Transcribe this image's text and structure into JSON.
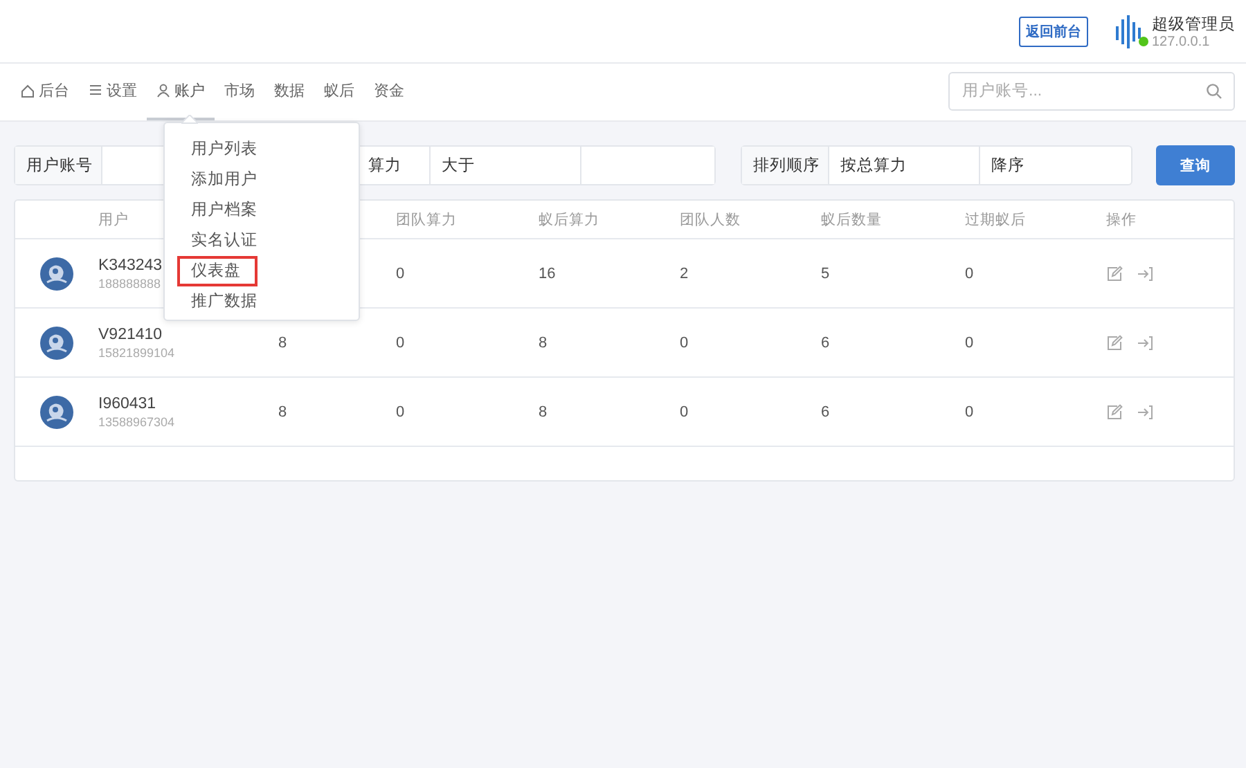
{
  "header": {
    "front_button": "返回前台",
    "user": {
      "name": "超级管理员",
      "ip": "127.0.0.1",
      "online": true
    }
  },
  "nav": {
    "items": [
      {
        "label": "后台",
        "selected": false
      },
      {
        "label": "设置",
        "selected": false
      },
      {
        "label": "账户",
        "selected": true
      },
      {
        "label": "市场",
        "selected": false
      },
      {
        "label": "数据",
        "selected": false
      },
      {
        "label": "蚁后",
        "selected": false
      },
      {
        "label": "资金",
        "selected": false
      }
    ],
    "search": {
      "placeholder": "用户账号..."
    }
  },
  "filters": {
    "account_label": "用户账号",
    "field_value": "算力",
    "compare": "大于",
    "sort_label": "排列顺序",
    "sort_by": "按总算力",
    "sort_order": "降序",
    "query_button": "查询"
  },
  "dropdown": {
    "items": [
      {
        "label": "用户列表",
        "highlighted": false
      },
      {
        "label": "添加用户",
        "highlighted": false
      },
      {
        "label": "用户档案",
        "highlighted": false
      },
      {
        "label": "实名认证",
        "highlighted": false
      },
      {
        "label": "仪表盘",
        "highlighted": true
      },
      {
        "label": "推广数据",
        "highlighted": false
      }
    ]
  },
  "table": {
    "columns": [
      "用户",
      null,
      "团队算力",
      "蚁后算力",
      "团队人数",
      "蚁后数量",
      "过期蚁后",
      "操作"
    ],
    "rows": [
      {
        "user": "K343243",
        "phone": "188888888",
        "column_3": null,
        "team_power": "0",
        "queen_power": "16",
        "team_size": "2",
        "queen_count": "5",
        "expired": "0"
      },
      {
        "user": "V921410",
        "phone": "15821899104",
        "column_3": "8",
        "team_power": "0",
        "queen_power": "8",
        "team_size": "0",
        "queen_count": "6",
        "expired": "0"
      },
      {
        "user": "I960431",
        "phone": "13588967304",
        "column_3": "8",
        "team_power": "0",
        "queen_power": "8",
        "team_size": "0",
        "queen_count": "6",
        "expired": "0"
      }
    ]
  }
}
